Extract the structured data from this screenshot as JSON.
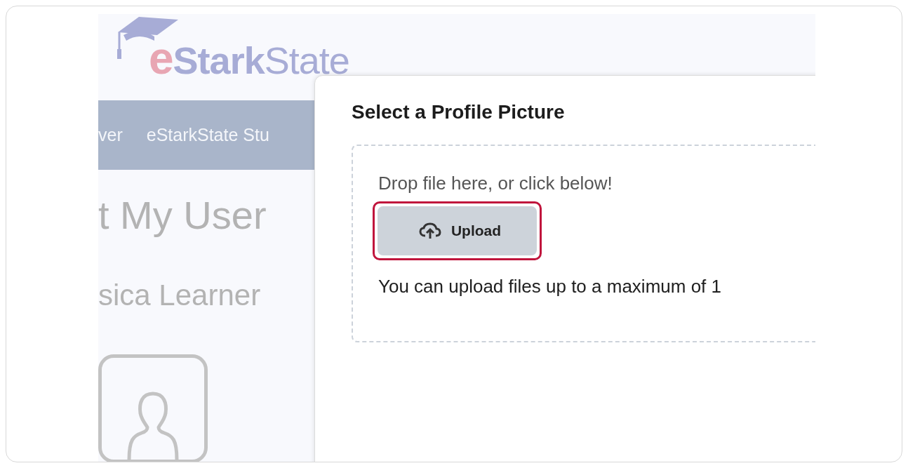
{
  "logo": {
    "parts": [
      {
        "text": "e",
        "kind": "accent"
      },
      {
        "text": "Stark",
        "kind": "bold"
      },
      {
        "text": "State",
        "kind": "light"
      }
    ]
  },
  "nav": {
    "items": [
      "ver",
      "eStarkState Stu"
    ]
  },
  "page": {
    "heading": "t My User",
    "name": "sica Learner"
  },
  "dialog": {
    "title": "Select a Profile Picture",
    "dropzone": {
      "prompt": "Drop file here, or click below!",
      "button": "Upload",
      "note": "You can upload files up to a maximum of 1"
    }
  }
}
